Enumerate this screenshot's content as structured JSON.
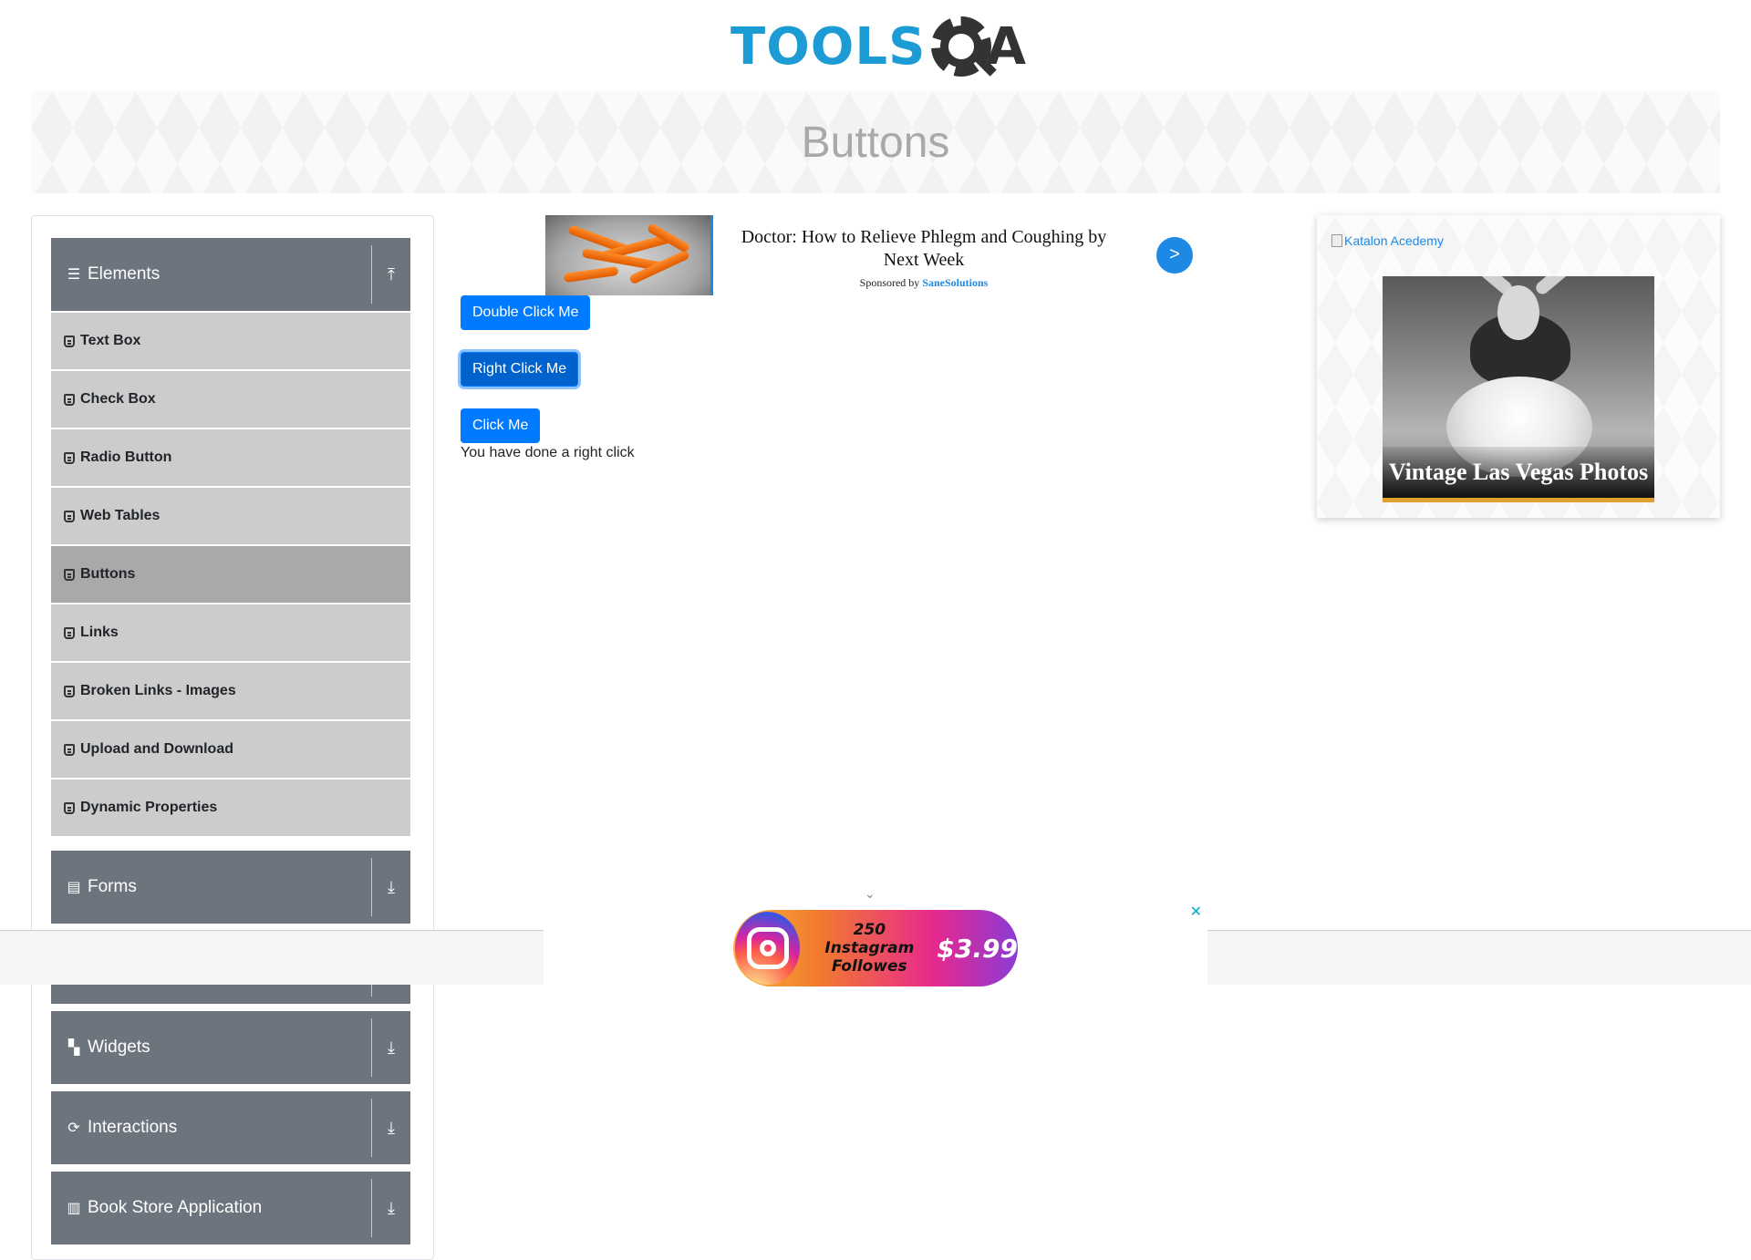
{
  "header": {
    "logo_tools": "TOOLS",
    "logo_a": "A",
    "page_title": "Buttons"
  },
  "sidebar": {
    "groups": [
      {
        "label": "Elements",
        "icon": "hamburger-icon",
        "expanded": true
      },
      {
        "label": "Forms",
        "icon": "document-icon",
        "expanded": false
      },
      {
        "label": "Widgets",
        "icon": "widgets-icon",
        "expanded": false
      },
      {
        "label": "Interactions",
        "icon": "refresh-icon",
        "expanded": false
      },
      {
        "label": "Book Store Application",
        "icon": "books-icon",
        "expanded": false
      }
    ],
    "items": [
      {
        "label": "Text Box"
      },
      {
        "label": "Check Box"
      },
      {
        "label": "Radio Button"
      },
      {
        "label": "Web Tables"
      },
      {
        "label": "Buttons",
        "active": true
      },
      {
        "label": "Links"
      },
      {
        "label": "Broken Links - Images"
      },
      {
        "label": "Upload and Download"
      },
      {
        "label": "Dynamic Properties"
      }
    ]
  },
  "ad_top": {
    "headline": "Doctor: How to Relieve Phlegm and Coughing by Next Week",
    "sponsor_prefix": "Sponsored by",
    "sponsor_name": "SaneSolutions",
    "go_label": ">"
  },
  "main": {
    "double_click_label": "Double Click Me",
    "right_click_label": "Right Click Me",
    "click_label": "Click Me",
    "result_text": "You have done a right click"
  },
  "right_ad": {
    "katalon_alt": "Katalon Acedemy",
    "caption": "Vintage Las Vegas Photos"
  },
  "bottom_ad": {
    "chevron": "⌄",
    "close": "✕",
    "line1": "250 Instagram",
    "line2": "Followes",
    "price": "$3.99"
  },
  "colors": {
    "primary": "#007bff",
    "sidebar_group": "#6c757d",
    "sidebar_item": "#cccccc",
    "sidebar_active": "#a9a9a9",
    "logo_blue": "#1d9bd4"
  }
}
